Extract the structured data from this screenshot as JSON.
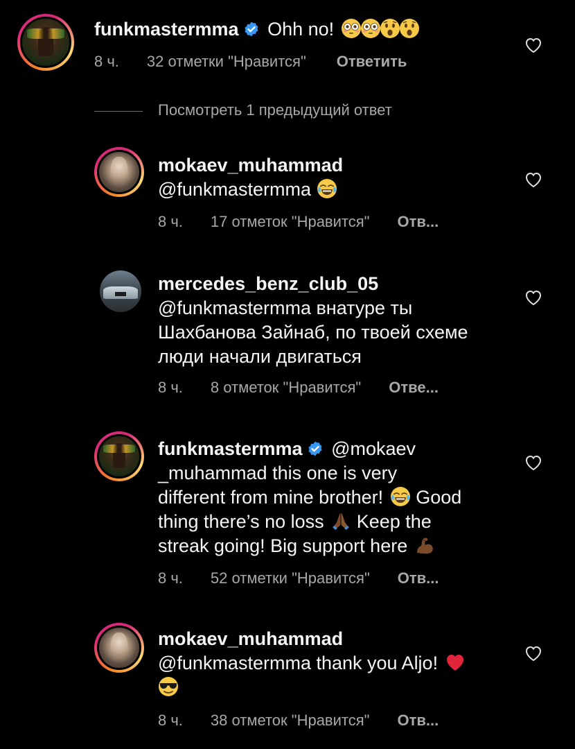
{
  "comments": [
    {
      "username": "funkmastermma",
      "verified": true,
      "text": "Ohh no!",
      "time": "8 ч.",
      "likes": "32 отметки \"Нравится\"",
      "reply": "Ответить"
    },
    {
      "username": "mokaev_muhammad",
      "verified": false,
      "text": "@funkmastermma",
      "time": "8 ч.",
      "likes": "17 отметок \"Нравится\"",
      "reply": "Отв..."
    },
    {
      "username": "mercedes_benz_club_05",
      "verified": false,
      "text_lines": [
        "@funkmastermma внатуре ты",
        "Шахбанова Зайнаб, по твоей схеме",
        "люди начали двигаться"
      ],
      "time": "8 ч.",
      "likes": "8 отметок \"Нравится\"",
      "reply": "Отве..."
    },
    {
      "username": "funkmastermma",
      "verified": true,
      "text_lines": [
        "@mokaev",
        "_muhammad this one is very",
        "different from mine brother!",
        "Good",
        "thing there’s no loss",
        "Keep the",
        "streak going! Big support here"
      ],
      "time": "8 ч.",
      "likes": "52 отметки \"Нравится\"",
      "reply": "Отв..."
    },
    {
      "username": "mokaev_muhammad",
      "verified": false,
      "text": "@funkmastermma thank you Aljo!",
      "time": "8 ч.",
      "likes": "38 отметок \"Нравится\"",
      "reply": "Отв..."
    }
  ],
  "view_previous": "Посмотреть 1 предыдущий ответ",
  "colors": {
    "background": "#000000",
    "text": "#f5f5f5",
    "meta": "#a8a8a8",
    "verified": "#3897f0"
  },
  "icons": {
    "like": "heart-outline-icon",
    "verified": "verified-badge-icon"
  }
}
